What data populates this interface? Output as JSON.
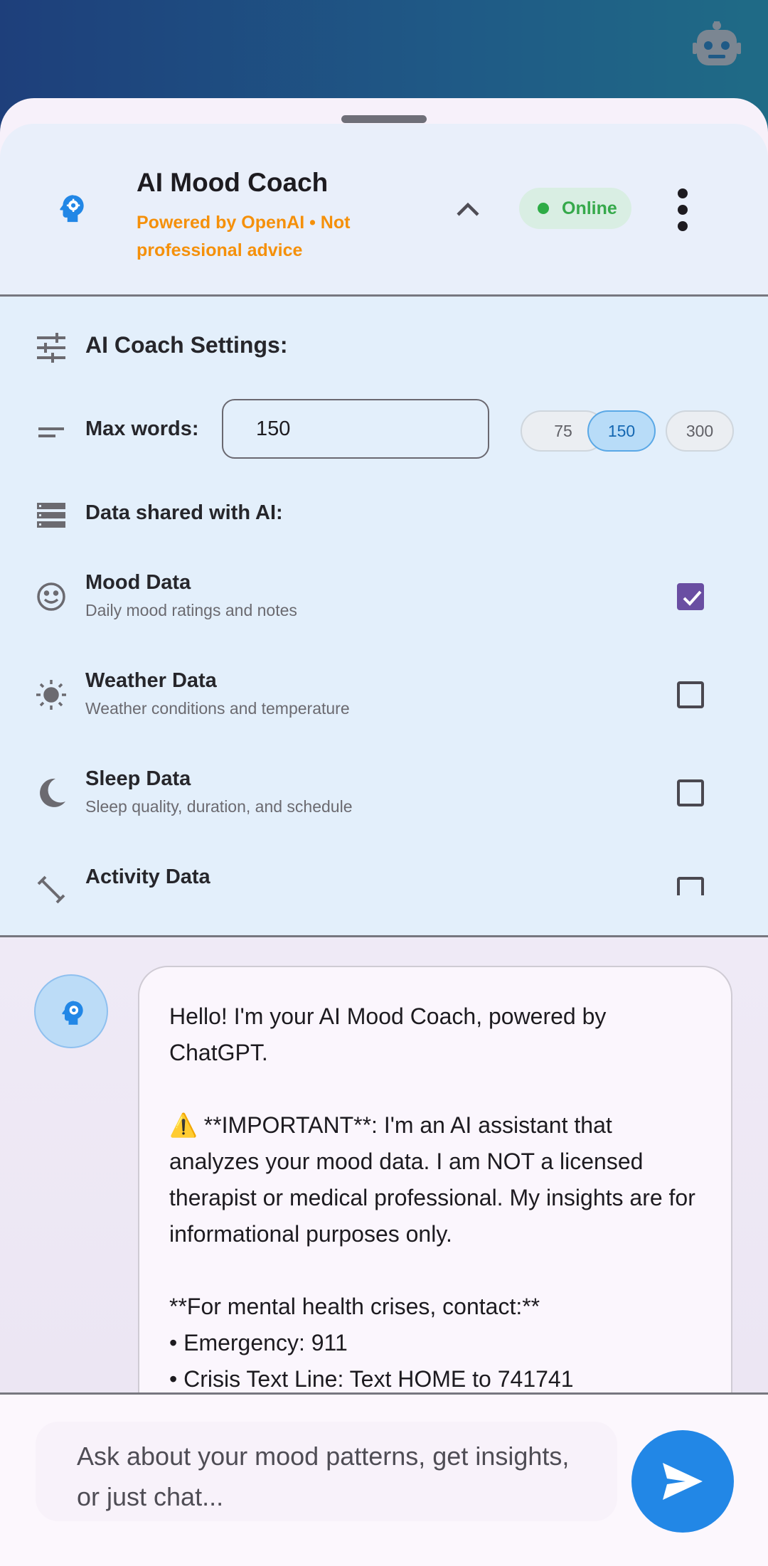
{
  "colors": {
    "accent_orange": "#f5900a",
    "online_green": "#36a94b",
    "checkbox_purple": "#6a4ea2",
    "send_blue": "#2287e6",
    "chip_selected": "#b8dcf8"
  },
  "header": {
    "title": "AI Mood Coach",
    "subtitle": "Powered by OpenAI • Not professional advice",
    "status": "Online",
    "icons": [
      "robot-icon",
      "psychology-icon",
      "chevron-up-icon",
      "more-vert-icon"
    ]
  },
  "settings": {
    "title": "AI Coach Settings:",
    "max_words_label": "Max words:",
    "max_words_value": "150",
    "presets": [
      "75",
      "150",
      "300"
    ],
    "selected_preset": "150",
    "data_shared_label": "Data shared with AI:",
    "items": [
      {
        "title": "Mood Data",
        "desc": "Daily mood ratings and notes",
        "checked": true,
        "icon": "mood-icon"
      },
      {
        "title": "Weather Data",
        "desc": "Weather conditions and temperature",
        "checked": false,
        "icon": "sun-icon"
      },
      {
        "title": "Sleep Data",
        "desc": "Sleep quality, duration, and schedule",
        "checked": false,
        "icon": "moon-icon"
      },
      {
        "title": "Activity Data",
        "desc": "",
        "checked": false,
        "icon": "fitness-icon"
      }
    ]
  },
  "chat": {
    "messages": [
      {
        "sender": "ai",
        "text": "Hello! I'm your AI Mood Coach, powered by ChatGPT.\n\n⚠️ **IMPORTANT**: I'm an AI assistant that analyzes your mood data. I am NOT a licensed therapist or medical professional. My insights are for informational purposes only.\n\n**For mental health crises, contact:**\n• Emergency: 911\n• Crisis Text Line: Text HOME to 741741"
      }
    ]
  },
  "composer": {
    "placeholder": "Ask about your mood patterns, get insights, or just chat..."
  }
}
